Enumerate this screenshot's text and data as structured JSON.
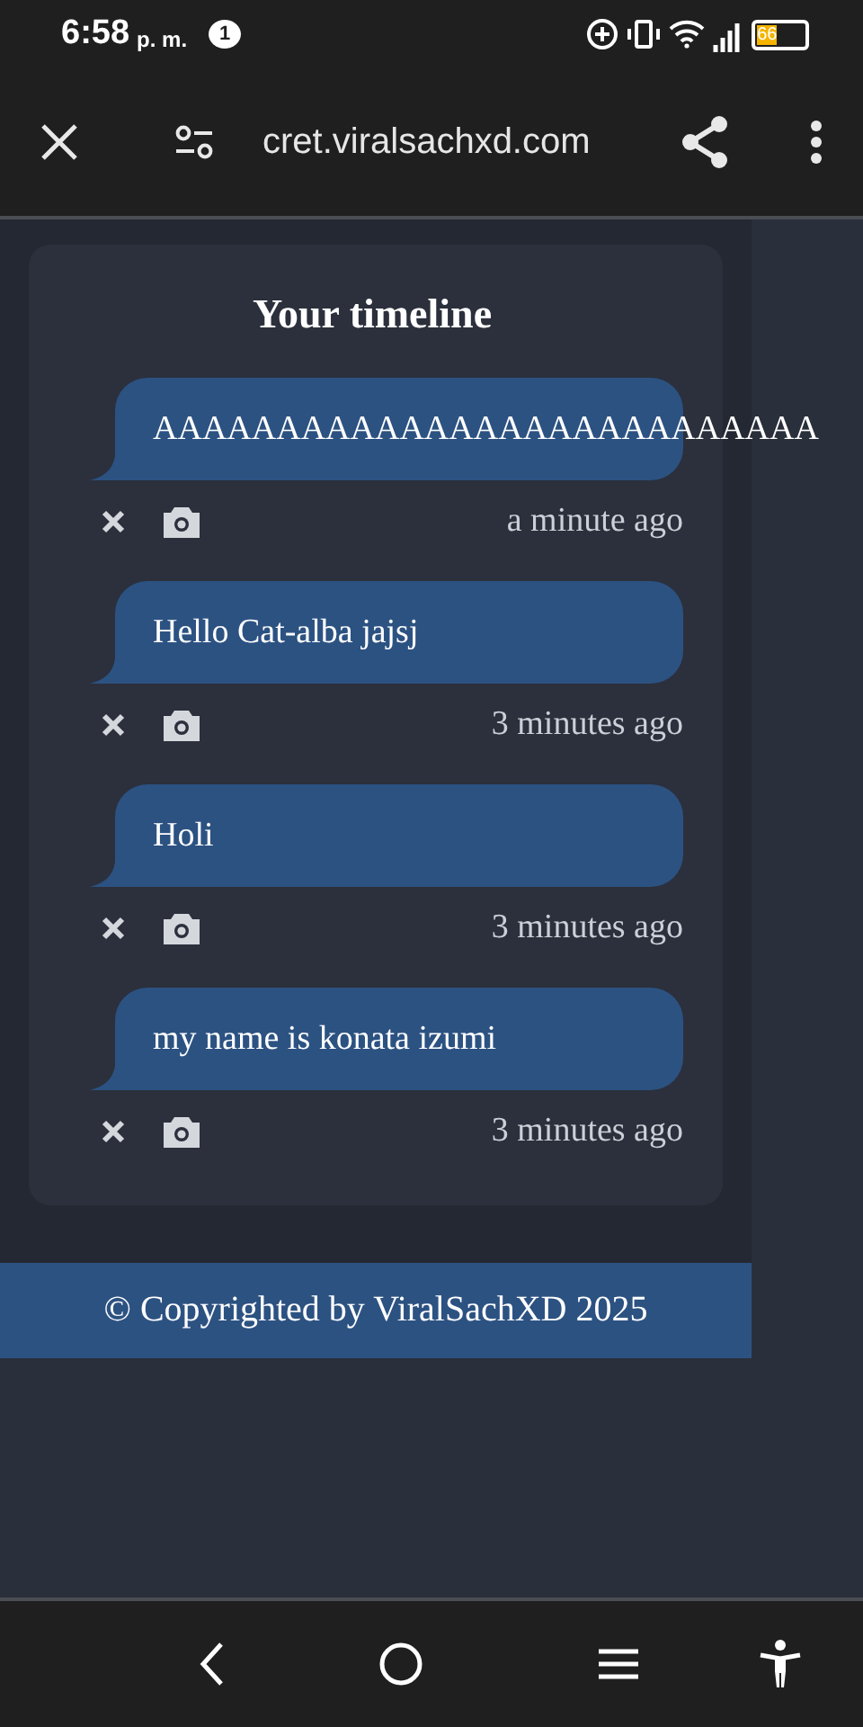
{
  "status_bar": {
    "time": "6:58",
    "ampm": "p. m.",
    "notification_count": "1",
    "battery": "66"
  },
  "browser_bar": {
    "url": "cret.viralsachxd.com"
  },
  "timeline": {
    "title": "Your timeline",
    "posts": [
      {
        "text": "AAAAAAAAAAAAAAAAAAAAAAAAAAA",
        "time": "a minute ago"
      },
      {
        "text": "Hello Cat-alba jajsj",
        "time": "3 minutes ago"
      },
      {
        "text": "Holi",
        "time": "3 minutes ago"
      },
      {
        "text": "my name is konata izumi",
        "time": "3 minutes ago"
      }
    ]
  },
  "footer": {
    "text": "© Copyrighted by ViralSachXD 2025"
  }
}
